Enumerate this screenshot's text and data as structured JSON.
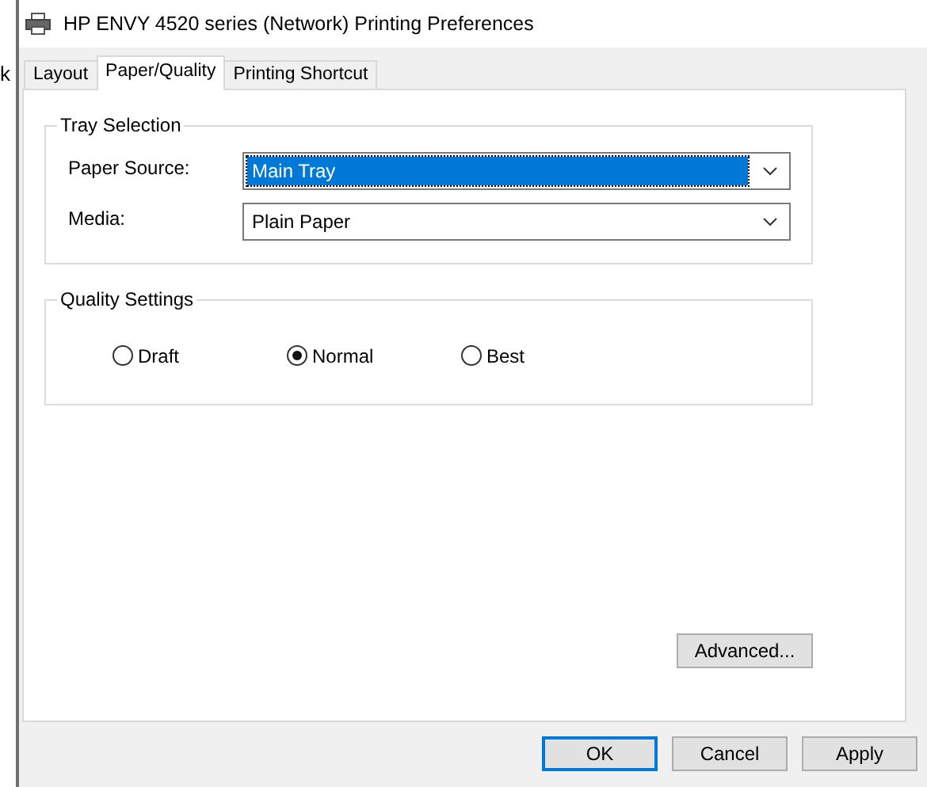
{
  "window": {
    "title": "HP ENVY 4520 series (Network) Printing Preferences"
  },
  "background_text": "k",
  "tabs": [
    {
      "label": "Layout",
      "selected": false
    },
    {
      "label": "Paper/Quality",
      "selected": true
    },
    {
      "label": "Printing Shortcut",
      "selected": false
    }
  ],
  "tray_selection": {
    "title": "Tray Selection",
    "fields": [
      {
        "label": "Paper Source:",
        "value": "Main Tray",
        "focused": true
      },
      {
        "label": "Media:",
        "value": "Plain Paper",
        "focused": false
      }
    ]
  },
  "quality_settings": {
    "title": "Quality Settings",
    "options": [
      {
        "label": "Draft",
        "selected": false
      },
      {
        "label": "Normal",
        "selected": true
      },
      {
        "label": "Best",
        "selected": false
      }
    ]
  },
  "advanced_button": "Advanced...",
  "buttons": [
    {
      "label": "OK",
      "default": true
    },
    {
      "label": "Cancel",
      "default": false
    },
    {
      "label": "Apply",
      "default": false
    }
  ]
}
